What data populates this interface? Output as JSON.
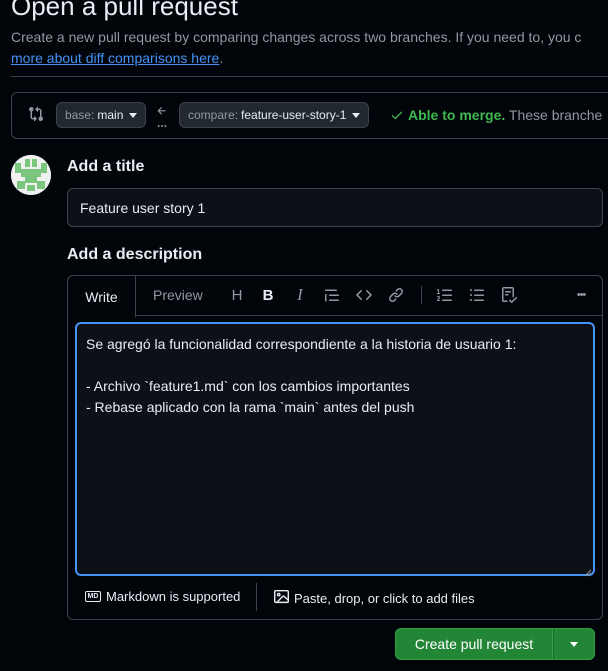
{
  "page": {
    "title": "Open a pull request",
    "subtitle_line1": "Create a new pull request by comparing changes across two branches. If you need to, you c",
    "subtitle_link": "more about diff comparisons here",
    "subtitle_end": "."
  },
  "branches": {
    "base_label": "base:",
    "base_value": "main",
    "compare_label": "compare:",
    "compare_value": "feature-user-story-1",
    "merge_ok": "Able to merge.",
    "merge_rest": "These branche"
  },
  "form": {
    "title_label": "Add a title",
    "title_value": "Feature user story 1",
    "description_label": "Add a description",
    "tabs": [
      "Write",
      "Preview"
    ],
    "body_value": "Se agregó la funcionalidad correspondiente a la historia de usuario 1:\n\n- Archivo `feature1.md` con los cambios importantes\n- Rebase aplicado con la rama `main` antes del push",
    "toolbar_icons": [
      "heading-icon",
      "bold-icon",
      "italic-icon",
      "quote-icon",
      "code-icon",
      "link-icon",
      "ordered-list-icon",
      "unordered-list-icon",
      "task-list-icon",
      "more-icon"
    ],
    "heading_glyph": "H",
    "bold_glyph": "B",
    "italic_glyph": "I",
    "code_glyph": "<>",
    "more_glyph": "•••",
    "markdown_note": "Markdown is supported",
    "attach_note": "Paste, drop, or click to add files",
    "markdown_badge": "MD"
  },
  "actions": {
    "create_label": "Create pull request"
  },
  "colors": {
    "background": "#010409",
    "border": "#3d444d",
    "accent_blue": "#4493f8",
    "success_green": "#3fb950",
    "button_green": "#238636"
  }
}
